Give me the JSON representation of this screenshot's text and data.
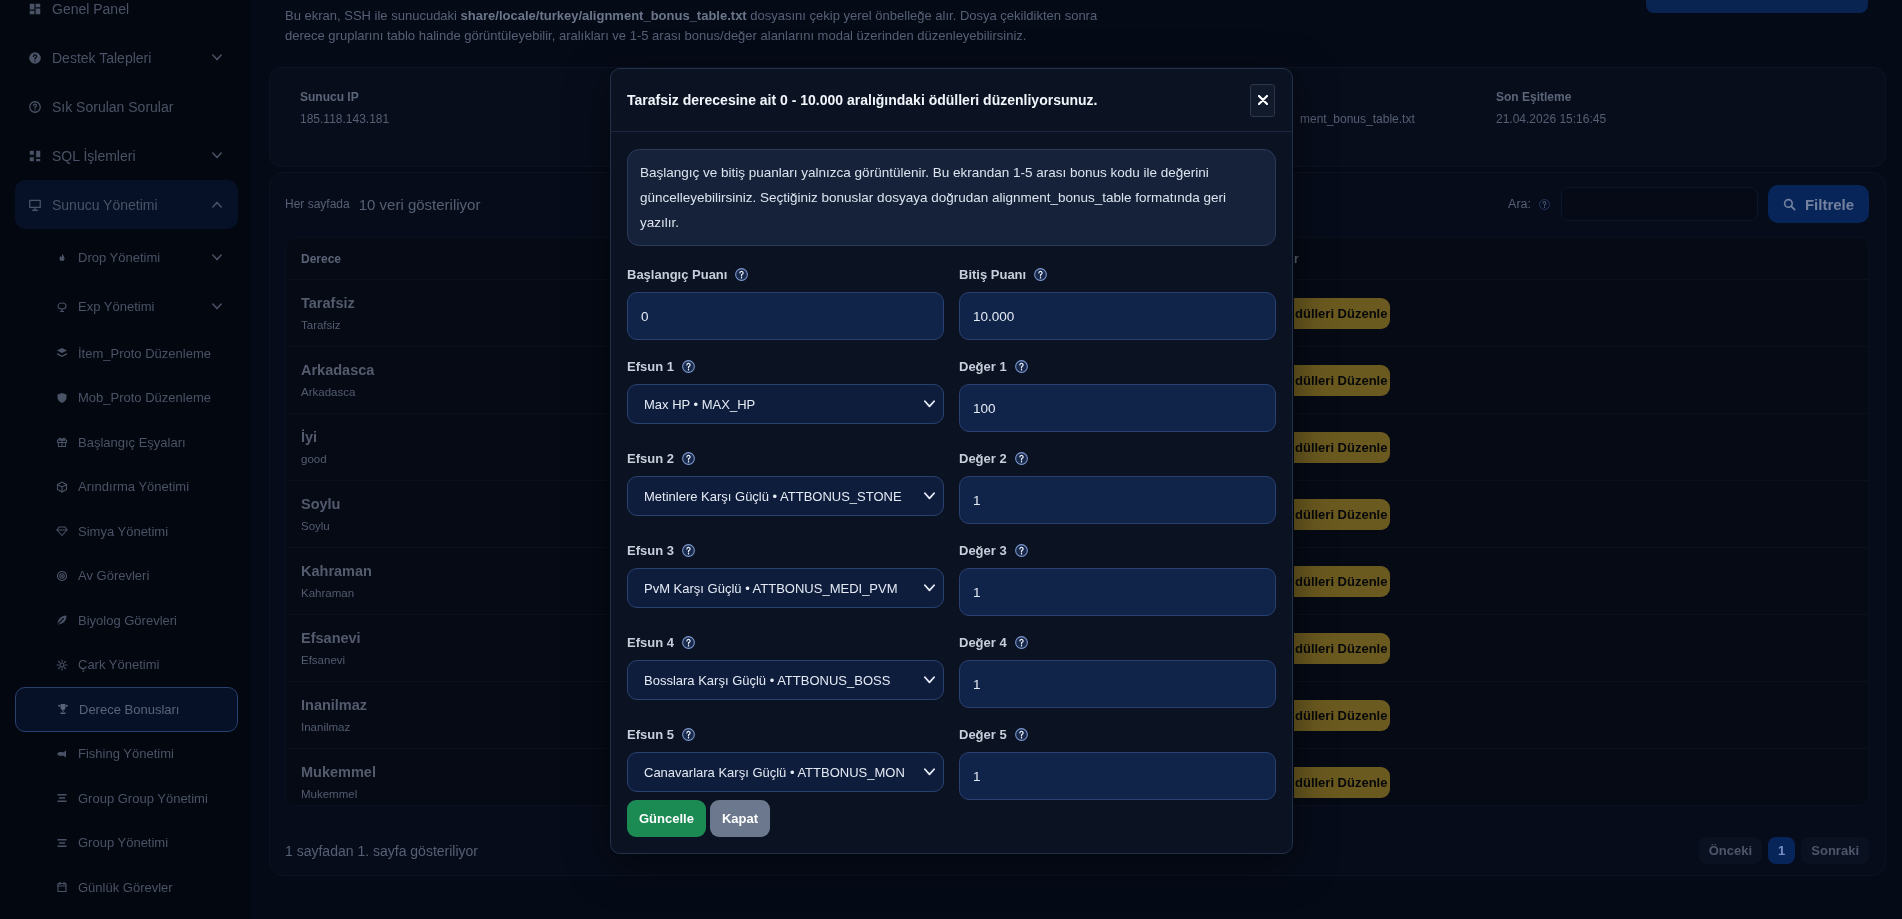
{
  "sidebar": {
    "items": [
      {
        "label": "Genel Panel",
        "kind": "link",
        "selected": false
      },
      {
        "label": "Destek Talepleri",
        "kind": "group",
        "expanded": false,
        "selected": false
      },
      {
        "label": "Sık Sorulan Sorular",
        "kind": "link",
        "selected": false
      },
      {
        "label": "SQL İşlemleri",
        "kind": "group",
        "expanded": false,
        "selected": false
      },
      {
        "label": "Sunucu Yönetimi",
        "kind": "group",
        "expanded": true,
        "selected": false,
        "children": [
          {
            "label": "Drop Yönetimi",
            "kind": "group",
            "expanded": false,
            "selected": false
          },
          {
            "label": "Exp Yönetimi",
            "kind": "group",
            "expanded": false,
            "selected": false
          },
          {
            "label": "İtem_Proto Düzenleme",
            "kind": "link",
            "selected": false
          },
          {
            "label": "Mob_Proto Düzenleme",
            "kind": "link",
            "selected": false
          },
          {
            "label": "Başlangıç Eşyaları",
            "kind": "link",
            "selected": false
          },
          {
            "label": "Arındırma Yönetimi",
            "kind": "link",
            "selected": false
          },
          {
            "label": "Simya Yönetimi",
            "kind": "link",
            "selected": false
          },
          {
            "label": "Av Görevleri",
            "kind": "link",
            "selected": false
          },
          {
            "label": "Biyolog Görevleri",
            "kind": "link",
            "selected": false
          },
          {
            "label": "Çark Yönetimi",
            "kind": "link",
            "selected": false
          },
          {
            "label": "Derece Bonusları",
            "kind": "link",
            "selected": true
          },
          {
            "label": "Fishing Yönetimi",
            "kind": "link",
            "selected": false
          },
          {
            "label": "Group Group Yönetimi",
            "kind": "link",
            "selected": false
          },
          {
            "label": "Group Yönetimi",
            "kind": "link",
            "selected": false
          },
          {
            "label": "Günlük Görevler",
            "kind": "link",
            "selected": false
          }
        ]
      }
    ]
  },
  "page": {
    "description": "Bu ekran, SSH ile sunucudaki **share/locale/turkey/alignment_bonus_table.txt** dosyasını çekip yerel önbelleğe alır. Dosya çekildikten sonra derece gruplarını tablo halinde görüntüleyebilir, aralıkları ve 1-5 arası bonus/değer alanlarını modal üzerinden düzenleyebilirsiniz.",
    "info_fields": [
      {
        "label": "Sunucu IP",
        "value": "185.118.143.181"
      },
      {
        "value": "ment_bonus_table.txt"
      },
      {
        "label": "Son Eşitleme",
        "value": "21.04.2026 15:16:45"
      }
    ]
  },
  "table": {
    "page_size_label": "Her sayfada",
    "page_size": "10 veri gösteriliyor",
    "search_label": "Ara:",
    "filter_button": "Filtrele",
    "columns": [
      "Derece",
      "r"
    ],
    "rows": [
      {
        "name": "Tarafsiz",
        "code": "Tarafsiz",
        "action": "dülleri Düzenle"
      },
      {
        "name": "Arkadasca",
        "code": "Arkadasca",
        "action": "dülleri Düzenle"
      },
      {
        "name": "İyi",
        "code": "good",
        "action": "dülleri Düzenle"
      },
      {
        "name": "Soylu",
        "code": "Soylu",
        "action": "dülleri Düzenle"
      },
      {
        "name": "Kahraman",
        "code": "Kahraman",
        "action": "dülleri Düzenle"
      },
      {
        "name": "Efsanevi",
        "code": "Efsanevi",
        "action": "dülleri Düzenle"
      },
      {
        "name": "Inanilmaz",
        "code": "Inanilmaz",
        "action": "dülleri Düzenle"
      },
      {
        "name": "Mukemmel",
        "code": "Mukemmel",
        "action": "dülleri Düzenle"
      }
    ],
    "footer": "1 sayfadan 1. sayfa gösteriliyor",
    "pagination": [
      {
        "label": "Önceki",
        "selected": false,
        "disabled": true
      },
      {
        "label": "1",
        "selected": true,
        "disabled": false
      },
      {
        "label": "Sonraki",
        "selected": false,
        "disabled": true
      }
    ]
  },
  "modal": {
    "title": "Tarafsiz derecesine ait 0 - 10.000 aralığındaki ödülleri düzenliyorsunuz.",
    "info": "Başlangıç ve bitiş puanları yalnızca görüntülenir. Bu ekrandan 1-5 arası bonus kodu ile değerini güncelleyebilirsiniz. Seçtiğiniz bonuslar dosyaya doğrudan alignment_bonus_table formatında geri yazılır.",
    "fields": [
      {
        "kind": "input",
        "label": "Başlangıç Puanı",
        "value": "0"
      },
      {
        "kind": "input",
        "label": "Bitiş Puanı",
        "value": "10.000"
      },
      {
        "kind": "select",
        "label": "Efsun 1",
        "value": "Max HP • MAX_HP"
      },
      {
        "kind": "input",
        "label": "Değer 1",
        "value": "100"
      },
      {
        "kind": "select",
        "label": "Efsun 2",
        "value": "Metinlere Karşı Güçlü • ATTBONUS_STONE"
      },
      {
        "kind": "input",
        "label": "Değer 2",
        "value": "1"
      },
      {
        "kind": "select",
        "label": "Efsun 3",
        "value": "PvM Karşı Güçlü • ATTBONUS_MEDI_PVM"
      },
      {
        "kind": "input",
        "label": "Değer 3",
        "value": "1"
      },
      {
        "kind": "select",
        "label": "Efsun 4",
        "value": "Bosslara Karşı Güçlü • ATTBONUS_BOSS"
      },
      {
        "kind": "input",
        "label": "Değer 4",
        "value": "1"
      },
      {
        "kind": "select",
        "label": "Efsun 5",
        "value": "Canavarlara Karşı Güçlü • ATTBONUS_MON"
      },
      {
        "kind": "input",
        "label": "Değer 5",
        "value": "1"
      }
    ],
    "buttons": [
      {
        "label": "Güncelle",
        "kind": "primary"
      },
      {
        "label": "Kapat",
        "kind": "secondary"
      }
    ]
  }
}
